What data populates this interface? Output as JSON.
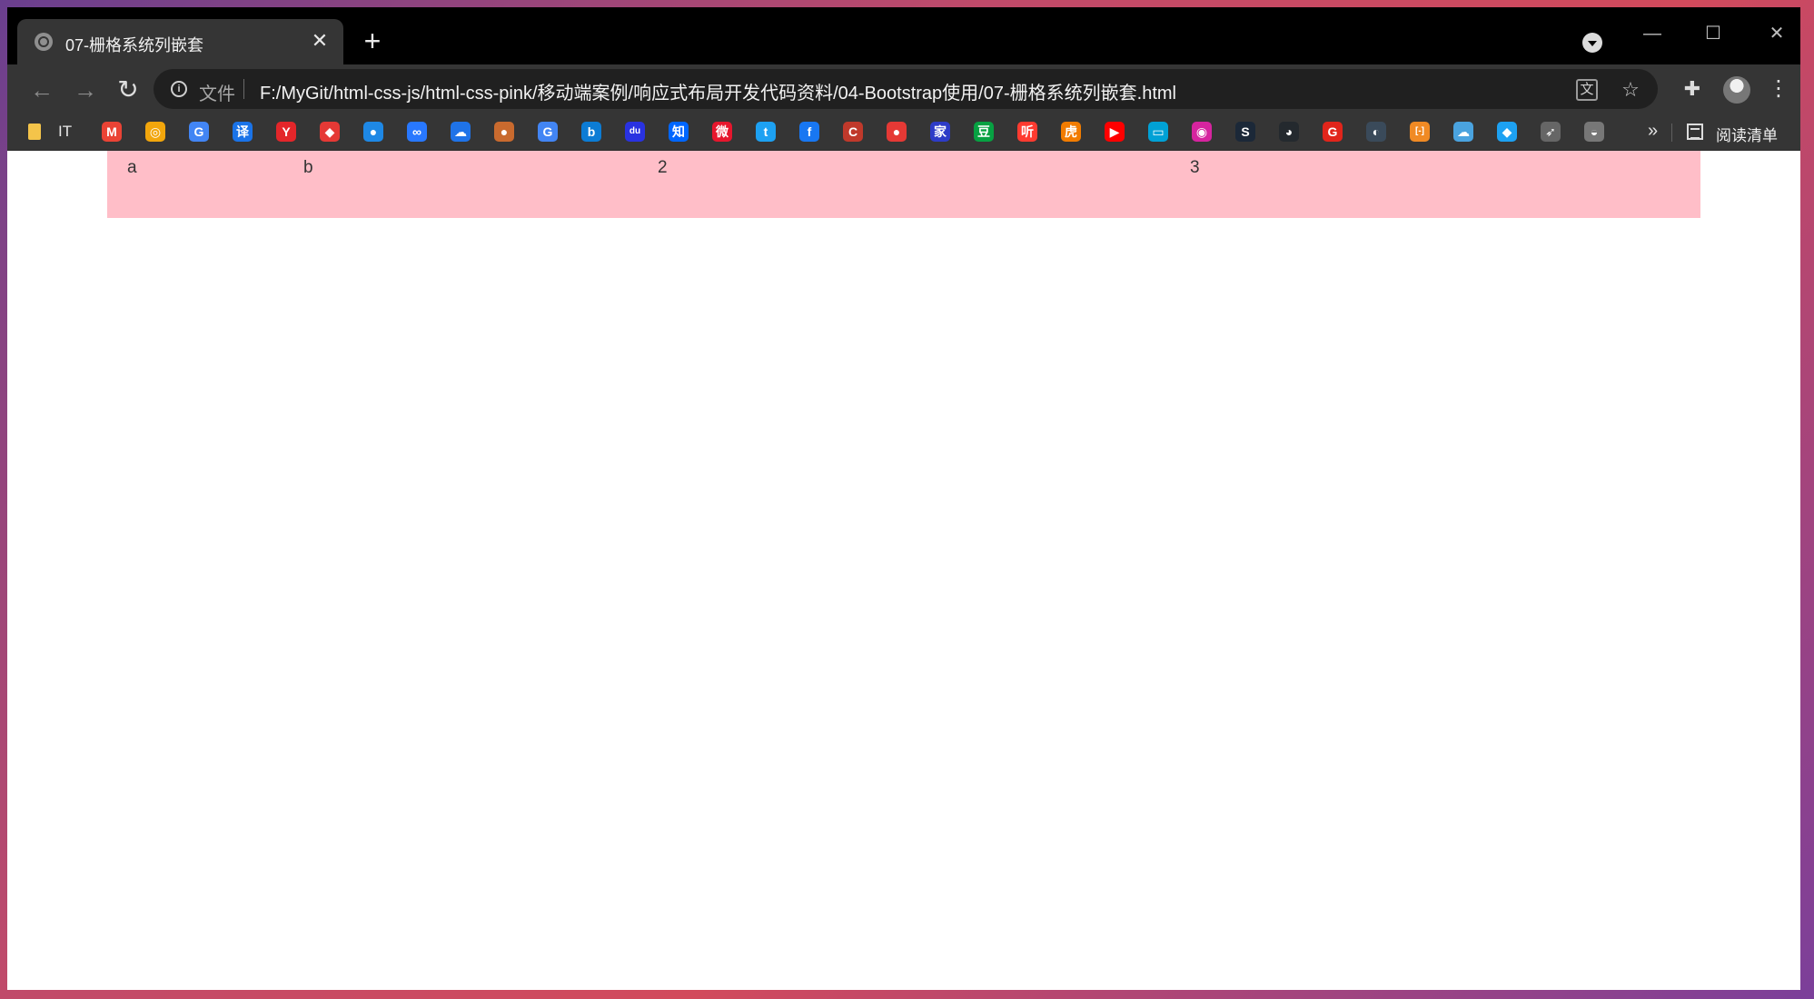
{
  "browser": {
    "tab": {
      "title": "07-栅格系统列嵌套"
    },
    "window_controls": {
      "minimize": "—",
      "maximize": "☐",
      "close": "✕"
    },
    "omnibox": {
      "scheme_label": "文件",
      "url": "F:/MyGit/html-css-js/html-css-pink/移动端案例/响应式布局开发代码资料/04-Bootstrap使用/07-栅格系统列嵌套.html"
    },
    "bookmarks": {
      "first_label": "IT",
      "reading_list_label": "阅读清单",
      "more": "»",
      "items": [
        {
          "icon": "gmail-icon",
          "glyph": "M",
          "color": "#ea4335"
        },
        {
          "icon": "chrome-circle-icon",
          "glyph": "◎",
          "color": "#f2a60c"
        },
        {
          "icon": "google-translate-icon",
          "glyph": "G",
          "color": "#4285f4"
        },
        {
          "icon": "yi-translate-icon",
          "glyph": "译",
          "color": "#1a73e8"
        },
        {
          "icon": "youdao-icon",
          "glyph": "Y",
          "color": "#e3262a"
        },
        {
          "icon": "maps-icon",
          "glyph": "◆",
          "color": "#e53935"
        },
        {
          "icon": "globe-icon",
          "glyph": "●",
          "color": "#1e88e5"
        },
        {
          "icon": "baidu-net-icon",
          "glyph": "∞",
          "color": "#2878ff"
        },
        {
          "icon": "cloud-icon",
          "glyph": "☁",
          "color": "#1f73e8"
        },
        {
          "icon": "nut-icon",
          "glyph": "●",
          "color": "#c96a2e"
        },
        {
          "icon": "google-icon",
          "glyph": "G",
          "color": "#4285f4"
        },
        {
          "icon": "bing-icon",
          "glyph": "b",
          "color": "#0c7cd5"
        },
        {
          "icon": "baidu-icon",
          "glyph": "du",
          "color": "#2932e1"
        },
        {
          "icon": "zhihu-icon",
          "glyph": "知",
          "color": "#0066ff"
        },
        {
          "icon": "weibo-icon",
          "glyph": "微",
          "color": "#e6162d"
        },
        {
          "icon": "twitter-icon",
          "glyph": "t",
          "color": "#1da1f2"
        },
        {
          "icon": "facebook-icon",
          "glyph": "f",
          "color": "#1877f2"
        },
        {
          "icon": "c-icon",
          "glyph": "C",
          "color": "#c0392b"
        },
        {
          "icon": "red-circle-icon",
          "glyph": "●",
          "color": "#e53935"
        },
        {
          "icon": "jia-icon",
          "glyph": "家",
          "color": "#2d3cc7"
        },
        {
          "icon": "douban-icon",
          "glyph": "豆",
          "color": "#07a142"
        },
        {
          "icon": "ting-icon",
          "glyph": "听",
          "color": "#ff3b30"
        },
        {
          "icon": "tiger-icon",
          "glyph": "虎",
          "color": "#f27c00"
        },
        {
          "icon": "youtube-icon",
          "glyph": "▶",
          "color": "#ff0000"
        },
        {
          "icon": "bilibili-icon",
          "glyph": "▭",
          "color": "#00a1d6"
        },
        {
          "icon": "instagram-icon",
          "glyph": "◉",
          "color": "#d6249f"
        },
        {
          "icon": "steam-icon",
          "glyph": "S",
          "color": "#1b2838"
        },
        {
          "icon": "github-icon",
          "glyph": "◕",
          "color": "#24292e"
        },
        {
          "icon": "g-red-icon",
          "glyph": "G",
          "color": "#e1251b"
        },
        {
          "icon": "dark-circle-icon",
          "glyph": "◐",
          "color": "#3a4a5a"
        },
        {
          "icon": "bracket-icon",
          "glyph": "[-]",
          "color": "#f08a24"
        },
        {
          "icon": "cloud-blue-icon",
          "glyph": "☁",
          "color": "#4aa3df"
        },
        {
          "icon": "bird-icon",
          "glyph": "◆",
          "color": "#1da1f2"
        },
        {
          "icon": "rocket-icon",
          "glyph": "➶",
          "color": "#666"
        },
        {
          "icon": "ufo-icon",
          "glyph": "◒",
          "color": "#777"
        }
      ]
    }
  },
  "page": {
    "cells": [
      "a",
      "b",
      "2",
      "3"
    ],
    "container_color": "#ffbec8"
  }
}
